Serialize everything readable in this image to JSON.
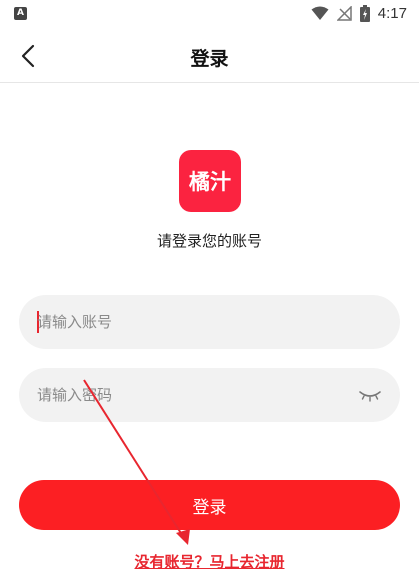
{
  "status_bar": {
    "indicator": "A",
    "time": "4:17",
    "icons": [
      "wifi-icon",
      "no-signal-icon",
      "battery-icon"
    ]
  },
  "nav": {
    "title": "登录",
    "back_icon": "chevron-left-icon"
  },
  "logo": {
    "text": "橘汁",
    "color": "#fb2340"
  },
  "subtitle": "请登录您的账号",
  "form": {
    "account_placeholder": "请输入账号",
    "password_placeholder": "请输入密码",
    "password_toggle_icon": "eye-closed-icon"
  },
  "login_button": "登录",
  "register_link": "没有账号？马上去注册",
  "colors": {
    "accent": "#fc1f23",
    "link": "#e8262f",
    "field_bg": "#f2f2f2"
  }
}
